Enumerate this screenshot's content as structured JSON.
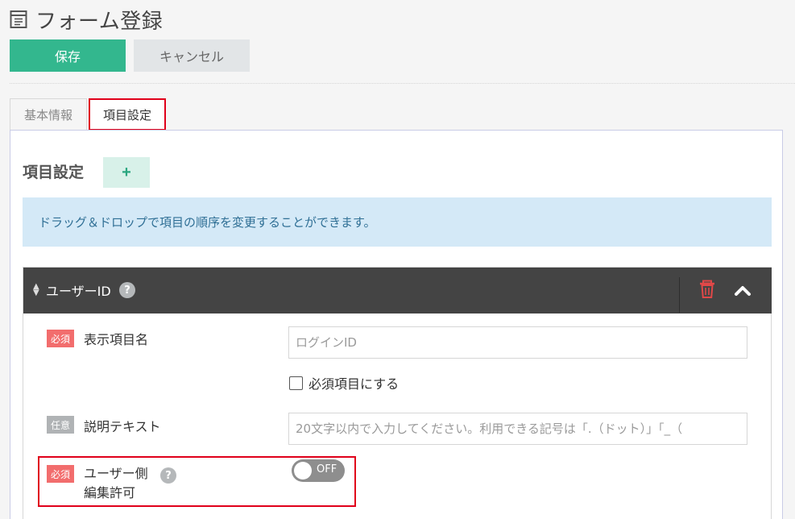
{
  "page": {
    "title": "フォーム登録"
  },
  "toolbar": {
    "save_label": "保存",
    "cancel_label": "キャンセル"
  },
  "tabs": [
    {
      "label": "基本情報",
      "active": false
    },
    {
      "label": "項目設定",
      "active": true
    }
  ],
  "section": {
    "title": "項目設定",
    "add_label": "+",
    "info": "ドラッグ＆ドロップで項目の順序を変更することができます。"
  },
  "field_card": {
    "name": "ユーザーID",
    "help": "?",
    "rows": {
      "display_name": {
        "tag": "必須",
        "label": "表示項目名",
        "placeholder": "ログインID"
      },
      "required_checkbox": {
        "label": "必須項目にする",
        "checked": false
      },
      "description": {
        "tag": "任意",
        "label": "説明テキスト",
        "placeholder": "20文字以内で入力してください。利用できる記号は「.（ドット）」「_（"
      },
      "user_edit": {
        "tag": "必須",
        "label_line1": "ユーザー側",
        "label_line2": "編集許可",
        "help": "?",
        "toggle_text": "OFF",
        "toggle_on": false
      }
    }
  },
  "colors": {
    "save": "#33b78e",
    "cancel": "#e2e5e7",
    "header": "#444444",
    "required_tag": "#f26d6d",
    "optional_tag": "#b0b3b5",
    "info_bg": "#d4e9f7",
    "highlight": "#e0001a",
    "trash": "#e04848"
  }
}
